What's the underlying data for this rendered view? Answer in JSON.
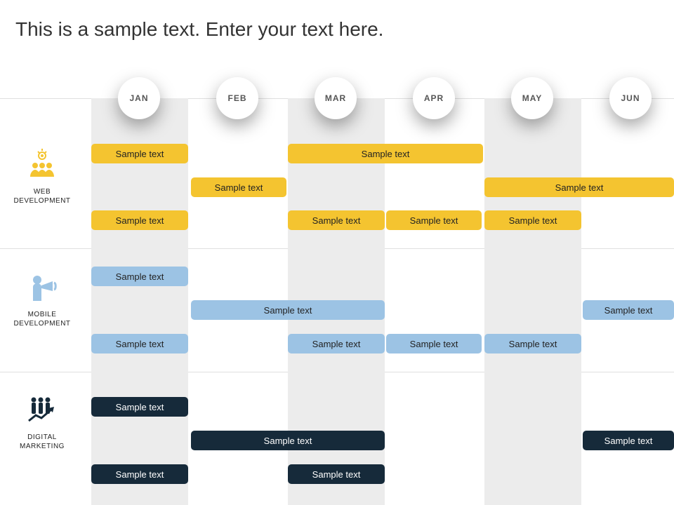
{
  "title": "This is a sample text. Enter your text here.",
  "months": [
    "JAN",
    "FEB",
    "MAR",
    "APR",
    "MAY",
    "JUN"
  ],
  "categories": [
    {
      "label_1": "WEB",
      "label_2": "DEVELOPMENT",
      "icon": "team"
    },
    {
      "label_1": "MOBILE",
      "label_2": "DEVELOPMENT",
      "icon": "megaphone"
    },
    {
      "label_1": "DIGITAL",
      "label_2": "MARKETING",
      "icon": "growth"
    }
  ],
  "bars": {
    "web_1": "Sample text",
    "web_2": "Sample text",
    "web_3": "Sample text",
    "web_4": "Sample text",
    "web_5": "Sample text",
    "web_6": "Sample text",
    "web_7": "Sample text",
    "web_8": "Sample text",
    "mob_1": "Sample text",
    "mob_2": "Sample text",
    "mob_3": "Sample text",
    "mob_4": "Sample text",
    "mob_5": "Sample text",
    "mob_6": "Sample text",
    "mob_7": "Sample text",
    "dig_1": "Sample text",
    "dig_2": "Sample text",
    "dig_3": "Sample text",
    "dig_4": "Sample text",
    "dig_5": "Sample text"
  }
}
